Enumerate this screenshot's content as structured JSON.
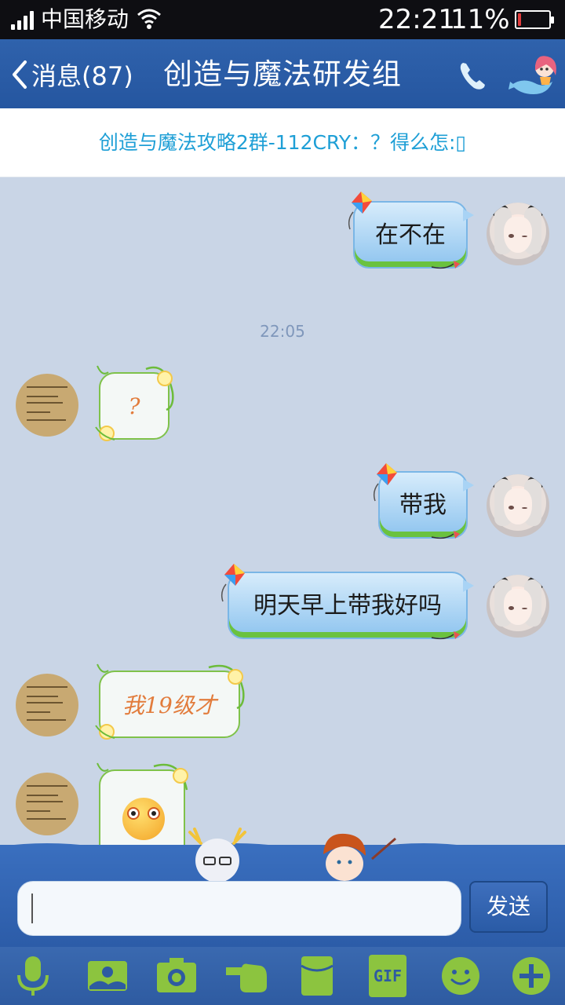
{
  "status_bar": {
    "carrier": "中国移动",
    "time": "22:21",
    "battery_percent": "11%",
    "battery_level": 0.11,
    "signal_bars": 4
  },
  "header": {
    "back_label": "消息(87)",
    "title": "创造与魔法研发组"
  },
  "notice": {
    "text": "创造与魔法攻略2群-112CRY：？得么怎:▯"
  },
  "messages": [
    {
      "side": "self",
      "type": "text",
      "text": "在不在"
    },
    {
      "side": "center",
      "type": "timestamp",
      "text": "22:05"
    },
    {
      "side": "other",
      "type": "text",
      "text": "?"
    },
    {
      "side": "self",
      "type": "text",
      "text": "带我"
    },
    {
      "side": "self",
      "type": "text",
      "text": "明天早上带我好吗"
    },
    {
      "side": "other",
      "type": "text",
      "text": "我19级才"
    },
    {
      "side": "other",
      "type": "emoji",
      "icon": "shocked-face-emoji"
    }
  ],
  "input": {
    "value": "",
    "placeholder": "",
    "send_label": "发送"
  },
  "toolbar": {
    "items": [
      {
        "name": "voice",
        "icon": "microphone-icon"
      },
      {
        "name": "picture",
        "icon": "image-icon"
      },
      {
        "name": "camera",
        "icon": "camera-icon"
      },
      {
        "name": "poke",
        "icon": "poke-hand-icon"
      },
      {
        "name": "red-packet",
        "icon": "red-packet-icon"
      },
      {
        "name": "gif",
        "icon": "gif-icon",
        "label": "GIF"
      },
      {
        "name": "emoji",
        "icon": "smiley-icon"
      },
      {
        "name": "more",
        "icon": "plus-icon"
      }
    ]
  },
  "colors": {
    "header_bg": "#2f62ac",
    "notice_text": "#1e9fd6",
    "chat_bg": "#c9d5e6",
    "self_bubble": "#8ec4ef",
    "other_bubble_border": "#7fc24a",
    "other_text": "#e27c3c",
    "toolbar_icon": "#8cc43f"
  }
}
